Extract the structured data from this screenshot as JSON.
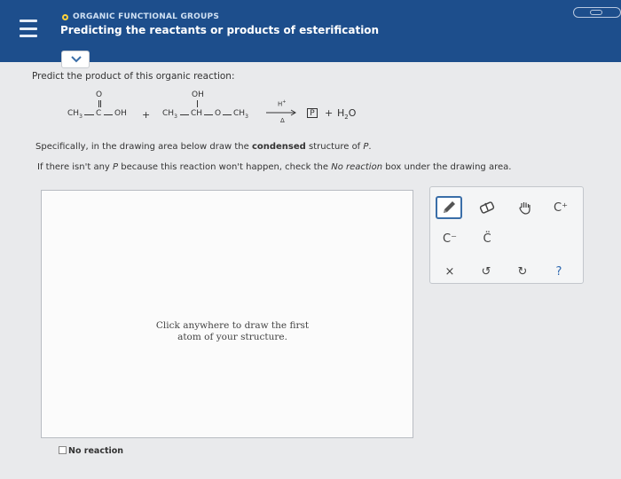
{
  "header": {
    "breadcrumb": "ORGANIC FUNCTIONAL GROUPS",
    "title": "Predicting the reactants or products of esterification"
  },
  "question": {
    "prompt": "Predict the product of this organic reaction:",
    "reaction": {
      "reactant1": {
        "o_label": "O",
        "left": "CH",
        "left_sub": "3",
        "center": "C",
        "right": "OH"
      },
      "plus1": "+",
      "reactant2": {
        "oh_label": "OH",
        "text1": "CH",
        "sub1": "3",
        "text2": "CH",
        "text3": "O",
        "text4": "CH",
        "sub4": "3"
      },
      "catalyst": "H",
      "catalyst_sup": "+",
      "heat": "Δ",
      "product_box": "P",
      "plus2": "+",
      "water": "H",
      "water_sub": "2",
      "water_end": "O"
    },
    "instruction1_a": "Specifically, in the drawing area below draw the ",
    "instruction1_b": "condensed",
    "instruction1_c": " structure of ",
    "instruction1_d": "P",
    "instruction1_e": ".",
    "instruction2_a": "If there isn't any ",
    "instruction2_b": "P",
    "instruction2_c": " because this reaction won't happen, check the ",
    "instruction2_d": "No reaction",
    "instruction2_e": " box under the drawing area."
  },
  "canvas": {
    "hint_line1": "Click anywhere to draw the first",
    "hint_line2": "atom of your structure."
  },
  "no_reaction_label": "No reaction",
  "toolbar": {
    "tools": [
      {
        "icon": "pencil-icon"
      },
      {
        "icon": "eraser-icon"
      },
      {
        "icon": "hand-icon"
      },
      {
        "icon": "charge-icon",
        "label": "C⁺"
      },
      {
        "icon": "negative-charge-icon",
        "label": "C⁻"
      },
      {
        "icon": "lone-pair-icon",
        "label": "C̈"
      },
      {
        "icon": "clear-icon",
        "label": "×"
      },
      {
        "icon": "undo-icon",
        "label": "↺"
      },
      {
        "icon": "redo-icon",
        "label": "↻"
      },
      {
        "icon": "help-icon",
        "label": "?"
      }
    ]
  },
  "colors": {
    "header_bg": "#1d4e8c",
    "accent": "#ffd23a",
    "tool_active": "#3a6ea8"
  }
}
